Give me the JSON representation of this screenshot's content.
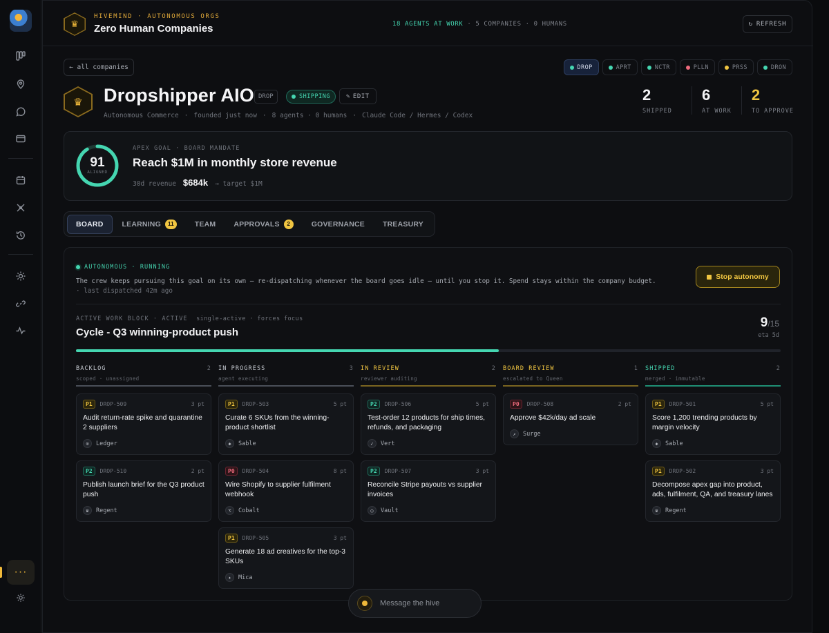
{
  "header": {
    "eyebrow": "HIVEMIND · AUTONOMOUS ORGS",
    "title": "Zero Human Companies",
    "stats_agents": "18 AGENTS AT WORK",
    "stats_rest": " · 5 COMPANIES · 0 HUMANS",
    "refresh_label": "REFRESH"
  },
  "nav": {
    "back_label": "← all companies",
    "tickers": [
      {
        "label": "DROP",
        "color": "#45d6b1",
        "active": true
      },
      {
        "label": "APRT",
        "color": "#45d6b1"
      },
      {
        "label": "NCTR",
        "color": "#45d6b1"
      },
      {
        "label": "PLLN",
        "color": "#ef6b7d"
      },
      {
        "label": "PRSS",
        "color": "#f0c541"
      },
      {
        "label": "DRON",
        "color": "#45d6b1"
      }
    ]
  },
  "company": {
    "name": "Dropshipper AIO",
    "tag": "DROP",
    "status": "SHIPPING",
    "edit_label": "EDIT",
    "meta": [
      "Autonomous Commerce",
      "founded just now",
      "8 agents · 0 humans",
      "Claude Code / Hermes / Codex"
    ],
    "kpis": [
      {
        "value": "2",
        "label": "SHIPPED"
      },
      {
        "value": "6",
        "label": "AT WORK"
      },
      {
        "value": "2",
        "label": "TO APPROVE"
      }
    ]
  },
  "goal": {
    "score": "91",
    "score_label": "ALIGNED",
    "score_fraction": 0.91,
    "eyebrow": "APEX GOAL · BOARD MANDATE",
    "title": "Reach $1M in monthly store revenue",
    "revenue_label": "30d revenue",
    "revenue_value": "$684k",
    "revenue_target": "→ target $1M"
  },
  "tabs": [
    {
      "label": "BOARD",
      "active": true
    },
    {
      "label": "LEARNING",
      "badge": "11"
    },
    {
      "label": "TEAM"
    },
    {
      "label": "APPROVALS",
      "badge": "2"
    },
    {
      "label": "GOVERNANCE"
    },
    {
      "label": "TREASURY"
    }
  ],
  "autonomy": {
    "status": "AUTONOMOUS · RUNNING",
    "description": "The crew keeps pursuing this goal on its own — re-dispatching whenever the board goes idle — until you stop it. Spend stays within the company budget.",
    "last_dispatched": "· last dispatched 42m ago",
    "stop_label": "Stop autonomy"
  },
  "block": {
    "eyebrow": "ACTIVE WORK BLOCK · ACTIVE",
    "eyebrow_extra": "single-active · forces focus",
    "title": "Cycle - Q3 winning-product push",
    "done": "9",
    "total": "/15",
    "eta": "eta 5d",
    "progress": 0.6
  },
  "columns": [
    {
      "title": "BACKLOG",
      "count": "2",
      "sub": "scoped · unassigned",
      "color": "#4a4f58",
      "title_color": "#c6cad1",
      "cards": [
        {
          "prio": "P1",
          "id": "DROP-509",
          "pts": "3 pt",
          "title": "Audit return-rate spike and quarantine 2 suppliers",
          "agent": "Ledger",
          "icon": "⊙"
        },
        {
          "prio": "P2",
          "id": "DROP-510",
          "pts": "2 pt",
          "title": "Publish launch brief for the Q3 product push",
          "agent": "Regent",
          "icon": "♛"
        }
      ]
    },
    {
      "title": "IN PROGRESS",
      "count": "3",
      "sub": "agent executing",
      "color": "#4a4f58",
      "title_color": "#c6cad1",
      "cards": [
        {
          "prio": "P1",
          "id": "DROP-503",
          "pts": "5 pt",
          "title": "Curate 6 SKUs from the winning-product shortlist",
          "agent": "Sable",
          "icon": "◈"
        },
        {
          "prio": "P0",
          "id": "DROP-504",
          "pts": "8 pt",
          "title": "Wire Shopify to supplier fulfilment webhook",
          "agent": "Cobalt",
          "icon": "⌥"
        },
        {
          "prio": "P1",
          "id": "DROP-505",
          "pts": "3 pt",
          "title": "Generate 18 ad creatives for the top-3 SKUs",
          "agent": "Mica",
          "icon": "✦"
        }
      ]
    },
    {
      "title": "IN REVIEW",
      "count": "2",
      "sub": "reviewer auditing",
      "color": "#7a6520",
      "title_color": "#f0c541",
      "cards": [
        {
          "prio": "P2",
          "id": "DROP-506",
          "pts": "5 pt",
          "title": "Test-order 12 products for ship times, refunds, and packaging",
          "agent": "Vert",
          "icon": "✓"
        },
        {
          "prio": "P2",
          "id": "DROP-507",
          "pts": "3 pt",
          "title": "Reconcile Stripe payouts vs supplier invoices",
          "agent": "Vault",
          "icon": "○"
        }
      ]
    },
    {
      "title": "BOARD REVIEW",
      "count": "1",
      "sub": "escalated to Queen",
      "color": "#7a6520",
      "title_color": "#f0c541",
      "cards": [
        {
          "prio": "P0",
          "id": "DROP-508",
          "pts": "2 pt",
          "title": "Approve $42k/day ad scale",
          "agent": "Surge",
          "icon": "↗"
        }
      ]
    },
    {
      "title": "SHIPPED",
      "count": "2",
      "sub": "merged · immutable",
      "color": "#1f8f74",
      "title_color": "#45d6b1",
      "cards": [
        {
          "prio": "P1",
          "id": "DROP-501",
          "pts": "5 pt",
          "title": "Score 1,200 trending products by margin velocity",
          "agent": "Sable",
          "icon": "◈"
        },
        {
          "prio": "P1",
          "id": "DROP-502",
          "pts": "3 pt",
          "title": "Decompose apex gap into product, ads, fulfilment, QA, and treasury lanes",
          "agent": "Regent",
          "icon": "♛"
        }
      ]
    }
  ],
  "chat": {
    "placeholder": "Message the hive"
  },
  "rail": {
    "icons": [
      "board-icon",
      "location-icon",
      "chat-icon",
      "wallet-icon",
      "calendar-icon",
      "network-icon",
      "history-icon",
      "sun-icon",
      "link-icon",
      "activity-icon"
    ],
    "more_label": "···"
  },
  "colors": {
    "accent": "#f0b93a",
    "teal": "#45d6b1",
    "red": "#ef6b7d"
  }
}
